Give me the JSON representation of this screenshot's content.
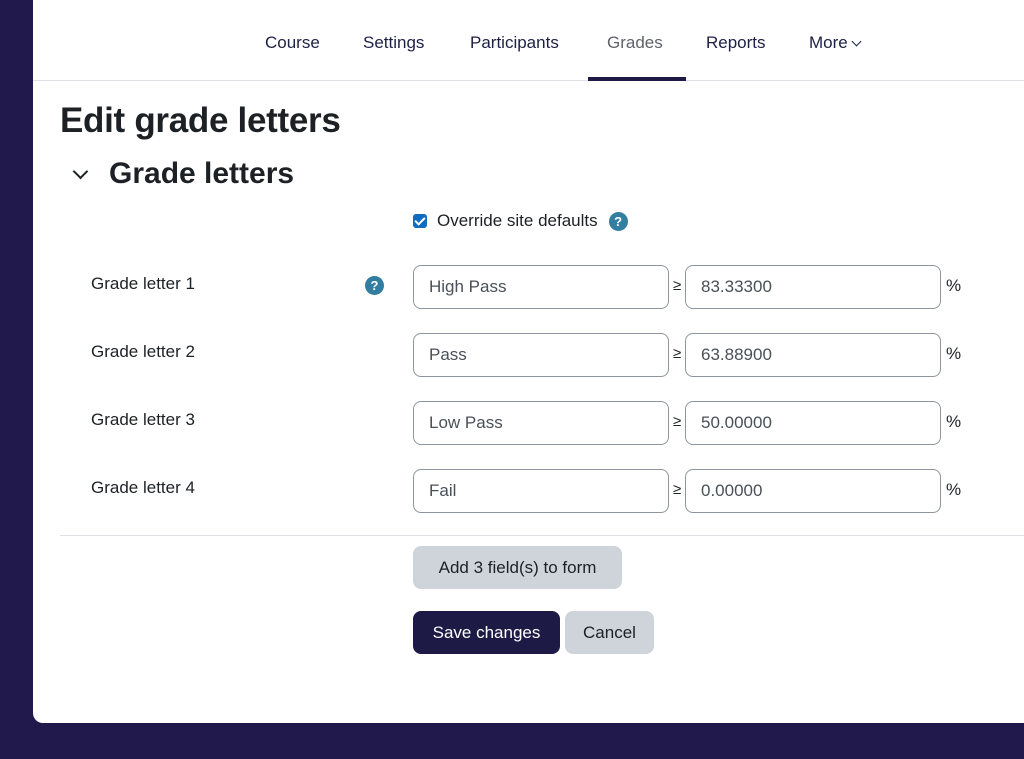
{
  "nav": {
    "items": [
      {
        "label": "Course"
      },
      {
        "label": "Settings"
      },
      {
        "label": "Participants"
      },
      {
        "label": "Grades",
        "active": true
      },
      {
        "label": "Reports"
      },
      {
        "label": "More"
      }
    ]
  },
  "page": {
    "title": "Edit grade letters",
    "section_title": "Grade letters",
    "override_label": "Override site defaults",
    "override_checked": true,
    "help_glyph": "?"
  },
  "grade_letters": [
    {
      "label": "Grade letter 1",
      "letter": "High Pass",
      "boundary": "83.33300"
    },
    {
      "label": "Grade letter 2",
      "letter": "Pass",
      "boundary": "63.88900"
    },
    {
      "label": "Grade letter 3",
      "letter": "Low Pass",
      "boundary": "50.00000"
    },
    {
      "label": "Grade letter 4",
      "letter": "Fail",
      "boundary": "0.00000"
    }
  ],
  "symbols": {
    "geq": "≥",
    "percent": "%"
  },
  "buttons": {
    "add_fields": "Add 3 field(s) to form",
    "save": "Save changes",
    "cancel": "Cancel"
  },
  "colors": {
    "brand": "#1e1a46",
    "help": "#317ea0",
    "checkbox": "#0f6cbf"
  }
}
